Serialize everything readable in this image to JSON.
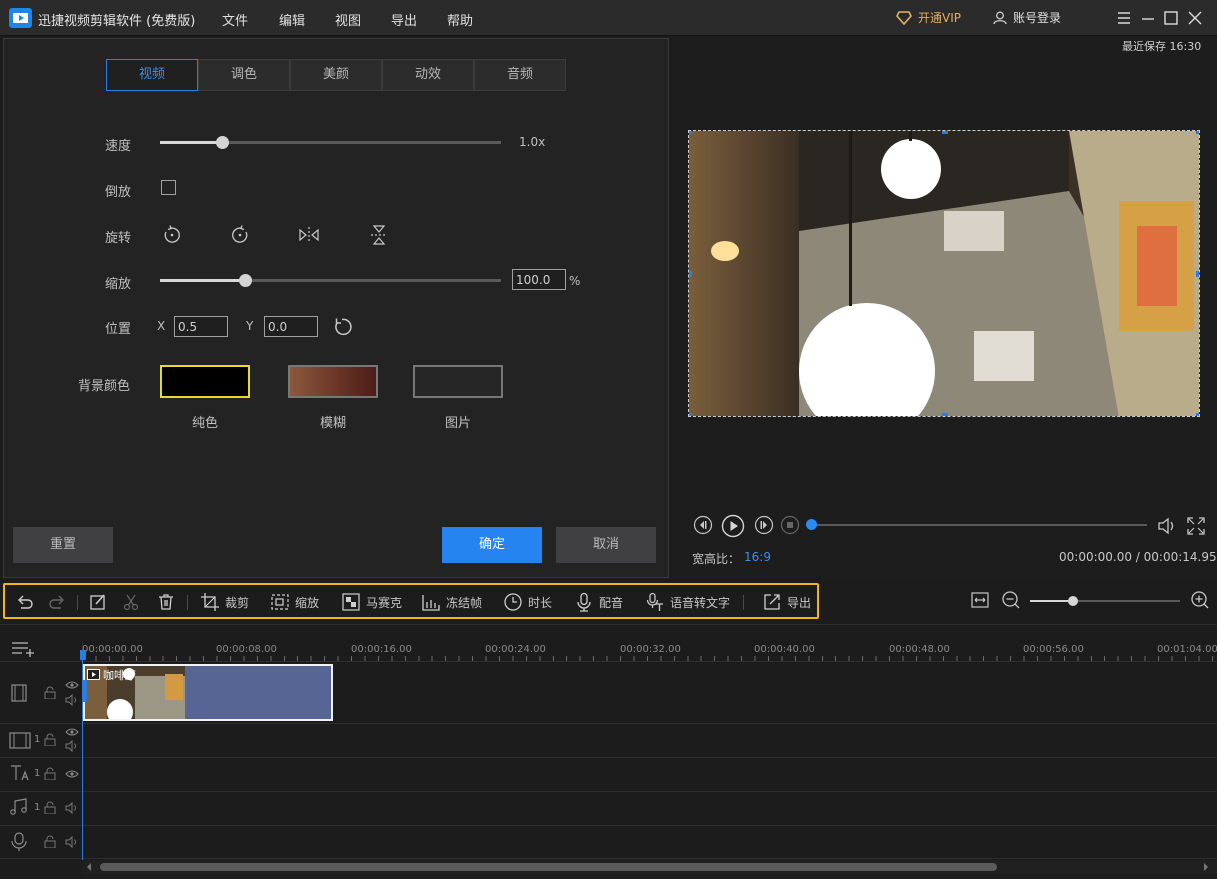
{
  "app": {
    "title": "迅捷视频剪辑软件 (免费版)",
    "menus": [
      "文件",
      "编辑",
      "视图",
      "导出",
      "帮助"
    ],
    "vip": "开通VIP",
    "login": "账号登录"
  },
  "tabs": [
    "视频",
    "调色",
    "美颜",
    "动效",
    "音频"
  ],
  "video_settings": {
    "speed_label": "速度",
    "speed_value": "1.0x",
    "speed_level": 0.18,
    "reverse_label": "倒放",
    "reverse_checked": false,
    "rotate_label": "旋转",
    "zoom_label": "缩放",
    "zoom_value": "100.0",
    "zoom_unit": "%",
    "zoom_level": 0.25,
    "position_label": "位置",
    "x_label": "X",
    "x_value": "0.5",
    "y_label": "Y",
    "y_value": "0.0",
    "bg_label": "背景颜色",
    "bg_options": [
      "纯色",
      "模糊",
      "图片"
    ]
  },
  "buttons": {
    "reset": "重置",
    "ok": "确定",
    "cancel": "取消"
  },
  "preview": {
    "last_saved": "最近保存 16:30",
    "aspect_label": "宽高比：",
    "aspect_value": "16:9",
    "time": "00:00:00.00 / 00:00:14.95",
    "progress": 0.0
  },
  "toolbar": {
    "crop": "裁剪",
    "zoom": "缩放",
    "mosaic": "马赛克",
    "freeze": "冻结帧",
    "duration": "时长",
    "dub": "配音",
    "speech_to_text": "语音转文字",
    "export": "导出"
  },
  "timeline": {
    "ticks": [
      "00:00:00.00",
      "00:00:08.00",
      "00:00:16.00",
      "00:00:24.00",
      "00:00:32.00",
      "00:00:40.00",
      "00:00:48.00",
      "00:00:56.00",
      "00:01:04.00"
    ],
    "clip_label": "咖啡厅",
    "track_numbers": [
      "1",
      "1",
      "1"
    ],
    "zoom_level": 0.28
  },
  "colors": {
    "accent": "#2b7de0",
    "toolbar_border": "#f3b41d",
    "vip": "#e4b060",
    "clip": "#566593"
  }
}
